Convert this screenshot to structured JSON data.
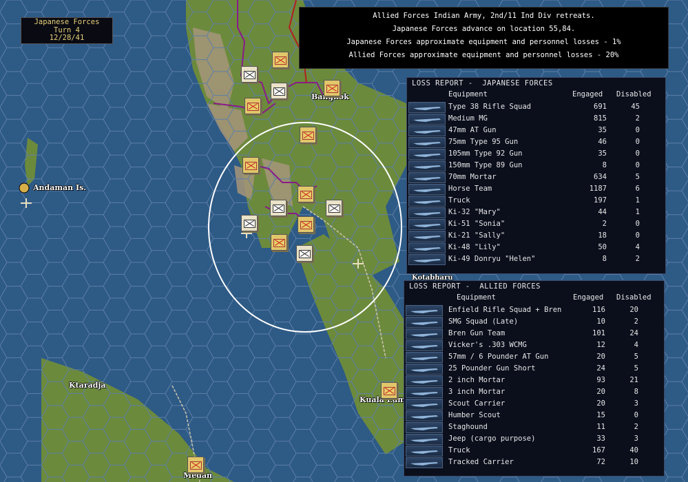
{
  "turn_info": {
    "side": "Japanese Forces",
    "turn": "Turn 4",
    "date": "12/28/41"
  },
  "combat_messages": [
    "Allied Forces Indian Army, 2nd/11 Ind Div retreats.",
    "Japanese Forces advance on location 55,84.",
    "Japanese Forces approximate equipment and personnel losses - 1%",
    "Allied Forces approximate equipment and personnel losses - 20%"
  ],
  "map_labels": {
    "bangkok": "Bangkok",
    "andaman": "Andaman Is.",
    "ktaradja": "Ktaradja",
    "kuala_lumpur": "Kuala Lum",
    "medan": "Medan",
    "kotabharu": "Kotabharu"
  },
  "japanese_report": {
    "title": "LOSS REPORT -  JAPANESE FORCES",
    "col_equipment": "Equipment",
    "col_engaged": "Engaged",
    "col_disabled": "Disabled",
    "rows": [
      {
        "name": "Type 38 Rifle Squad",
        "engaged": "691",
        "disabled": "45",
        "icon": "rifle-icon"
      },
      {
        "name": "Medium MG",
        "engaged": "815",
        "disabled": "2",
        "icon": "machine-gun-icon"
      },
      {
        "name": "47mm AT Gun",
        "engaged": "35",
        "disabled": "0",
        "icon": "at-gun-icon"
      },
      {
        "name": "75mm Type 95 Gun",
        "engaged": "46",
        "disabled": "0",
        "icon": "artillery-icon"
      },
      {
        "name": "105mm Type 92 Gun",
        "engaged": "35",
        "disabled": "0",
        "icon": "artillery-icon"
      },
      {
        "name": "150mm Type 89 Gun",
        "engaged": "8",
        "disabled": "0",
        "icon": "artillery-icon"
      },
      {
        "name": "70mm Mortar",
        "engaged": "634",
        "disabled": "5",
        "icon": "mortar-icon"
      },
      {
        "name": "Horse Team",
        "engaged": "1187",
        "disabled": "6",
        "icon": "horse-icon"
      },
      {
        "name": "Truck",
        "engaged": "197",
        "disabled": "1",
        "icon": "truck-icon"
      },
      {
        "name": "Ki-32 \"Mary\"",
        "engaged": "44",
        "disabled": "1",
        "icon": "aircraft-icon"
      },
      {
        "name": "Ki-51 \"Sonia\"",
        "engaged": "2",
        "disabled": "0",
        "icon": "aircraft-icon"
      },
      {
        "name": "Ki-21 \"Sally\"",
        "engaged": "18",
        "disabled": "0",
        "icon": "aircraft-icon"
      },
      {
        "name": "Ki-48 \"Lily\"",
        "engaged": "50",
        "disabled": "4",
        "icon": "aircraft-icon"
      },
      {
        "name": "Ki-49 Donryu \"Helen\"",
        "engaged": "8",
        "disabled": "2",
        "icon": "aircraft-icon"
      }
    ]
  },
  "allied_report": {
    "title": "LOSS REPORT -  ALLIED FORCES",
    "col_equipment": "Equipment",
    "col_engaged": "Engaged",
    "col_disabled": "Disabled",
    "rows": [
      {
        "name": "Enfield Rifle Squad + Bren",
        "engaged": "116",
        "disabled": "20",
        "icon": "rifle-icon"
      },
      {
        "name": "SMG Squad (Late)",
        "engaged": "10",
        "disabled": "2",
        "icon": "smg-icon"
      },
      {
        "name": "Bren Gun Team",
        "engaged": "101",
        "disabled": "24",
        "icon": "machine-gun-icon"
      },
      {
        "name": "Vicker's .303 WCMG",
        "engaged": "12",
        "disabled": "4",
        "icon": "machine-gun-icon"
      },
      {
        "name": "57mm / 6 Pounder AT Gun",
        "engaged": "20",
        "disabled": "5",
        "icon": "at-gun-icon"
      },
      {
        "name": "25 Pounder Gun Short",
        "engaged": "24",
        "disabled": "5",
        "icon": "artillery-icon"
      },
      {
        "name": "2 inch Mortar",
        "engaged": "93",
        "disabled": "21",
        "icon": "mortar-icon"
      },
      {
        "name": "3 inch Mortar",
        "engaged": "20",
        "disabled": "8",
        "icon": "mortar-icon"
      },
      {
        "name": "Scout Carrier",
        "engaged": "20",
        "disabled": "3",
        "icon": "carrier-icon"
      },
      {
        "name": "Humber Scout",
        "engaged": "15",
        "disabled": "0",
        "icon": "armored-car-icon"
      },
      {
        "name": "Staghound",
        "engaged": "11",
        "disabled": "2",
        "icon": "armored-car-icon"
      },
      {
        "name": "Jeep (cargo purpose)",
        "engaged": "33",
        "disabled": "3",
        "icon": "jeep-icon"
      },
      {
        "name": "Truck",
        "engaged": "167",
        "disabled": "40",
        "icon": "truck-icon"
      },
      {
        "name": "Tracked Carrier",
        "engaged": "72",
        "disabled": "10",
        "icon": "carrier-icon"
      }
    ]
  },
  "colors": {
    "sea": "#2e5a86",
    "land": "#6c8a3c",
    "japanese_border": "#8a1a8a",
    "report_bg": "#0b0f1c"
  }
}
